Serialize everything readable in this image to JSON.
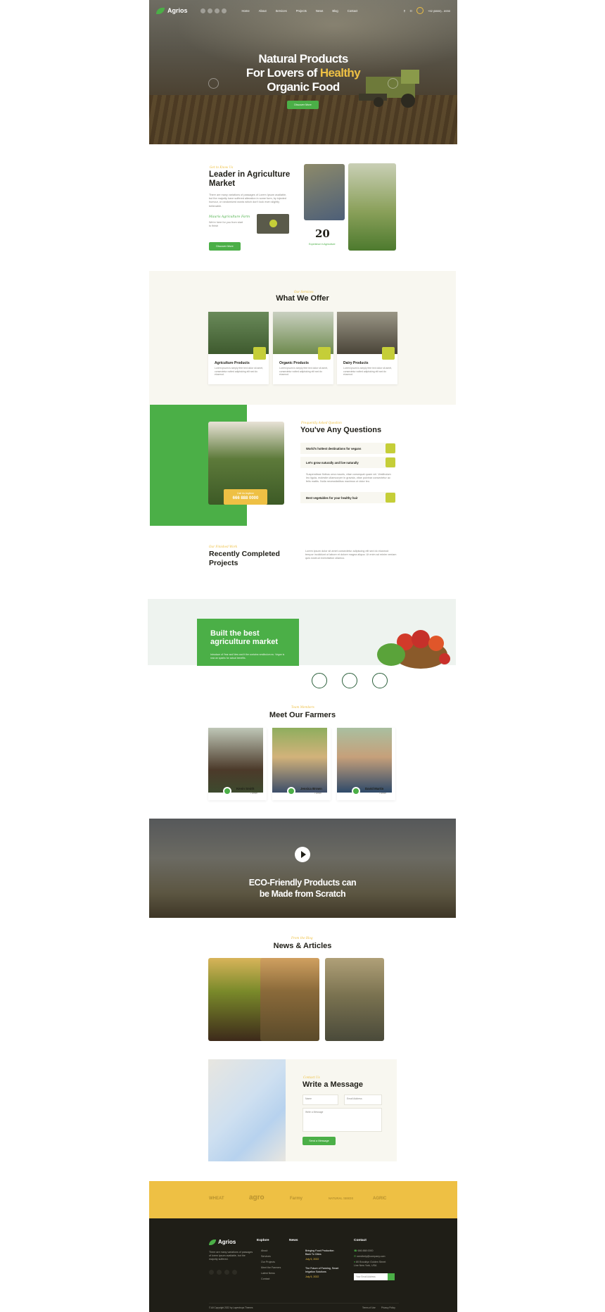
{
  "header": {
    "logo": "Agrios",
    "nav": [
      "Home",
      "About",
      "Services",
      "Projects",
      "News",
      "Blog",
      "Contact"
    ],
    "phone": "+92 (8800) - 6930"
  },
  "hero": {
    "title_line1": "Natural Products",
    "title_line2a": "For Lovers of",
    "title_line2b": "Healthy",
    "title_line3": "Organic Food",
    "button": "Discover More"
  },
  "about": {
    "tag": "Get to Know Us",
    "title": "Leader in Agriculture Market",
    "text": "There are many variations of passages of Lorem Ipsum available, but the majority have suffered alteration in some form, by injected humour, or randomized words which don't look even slightly believable.",
    "signature_note": "Mauris Agriculture Farm",
    "sub_text": "We're here for you from start to finish",
    "button": "Discover More",
    "years_number": "20",
    "years_label": "Experience in Agriculture"
  },
  "offer": {
    "tag": "Our Services",
    "title": "What We Offer",
    "cards": [
      {
        "title": "Agriculture Products",
        "text": "Lorem ipsum is simply free text dolor sit amet, consectetur notted adipisicing elit sed do eiusmod."
      },
      {
        "title": "Organic Products",
        "text": "Lorem ipsum is simply free text dolor sit amet, consectetur notted adipisicing elit sed do eiusmod."
      },
      {
        "title": "Dairy Products",
        "text": "Lorem ipsum is simply free text dolor sit amet, consectetur notted adipisicing elit sed do eiusmod."
      }
    ]
  },
  "faq": {
    "tag": "Frequently Asked Question",
    "title": "You've Any Questions",
    "call_label": "Call Us Anytime",
    "call_number": "666 888 0000",
    "items": [
      "World's hottest destinations for vegans",
      "Let's grow naturally and live naturally",
      "Best vegetables for your healthy hair"
    ],
    "answer": "Suspendisse finibus urna mauris, vitae consequat quam vel. Vestibulum leo ligula, molestie ullamcorper in gravida, vitae pulvinar consectetur ac felis mattis. Nulla necessitatibus maximus ut dolor leo."
  },
  "projects": {
    "tag": "Our Finished Work",
    "title": "Recently Completed Projects",
    "text": "Lorem ipsum dolor sit amet consectetur adipiscing elit sed do eiusmod tempor incididunt ut labore et dolore magna aliqua. Ut enim ad minim veniam quis nostrud exercitation ullamco."
  },
  "market": {
    "title": "Built the best agriculture market",
    "text": "Introduce of Year and New and it the contains vestibulum eu. Vegan is now an sparks for actual benefits."
  },
  "farmers": {
    "tag": "Team Members",
    "title": "Meet Our Farmers",
    "list": [
      {
        "name": "Kevin Smith",
        "role": "Farmer"
      },
      {
        "name": "Jessica Brown",
        "role": "Farmer"
      },
      {
        "name": "David Martin",
        "role": "Farmer"
      }
    ]
  },
  "video": {
    "title_line1": "ECO-Friendly Products can",
    "title_line2": "be Made from Scratch"
  },
  "news": {
    "tag": "From the Blog",
    "title": "News & Articles"
  },
  "contact": {
    "tag": "Contact Us",
    "title": "Write a Message",
    "name_placeholder": "Name",
    "email_placeholder": "Email Address",
    "message_placeholder": "Write a Message",
    "button": "Send a Message"
  },
  "brands": [
    "WHEAT",
    "agro",
    "Farmy",
    "NATURAL SEEDS",
    "AGRIC"
  ],
  "footer": {
    "logo": "Agrios",
    "about": "There are many variations of passages of lorem ipsum available, but the majority suffered.",
    "explore_title": "Explore",
    "explore": [
      "About",
      "Services",
      "Our Projects",
      "Meet the Farmers",
      "Latest News",
      "Contact"
    ],
    "news_title": "News",
    "news_items": [
      {
        "title": "Bringing Food Production Back To Cities",
        "date": "July 5, 2022"
      },
      {
        "title": "The Future of Farming, Smart Irrigation Solutions",
        "date": "July 5, 2022"
      }
    ],
    "contact_title": "Contact",
    "phone": "666 888 0000",
    "email": "needhelp@company.com",
    "address": "80 Brooklyn Golden Street Line New York, USA",
    "email_placeholder": "Your Email Address",
    "copyright": "© All Copyright 2022 by Layerdrops Themes",
    "terms": "Terms of Use",
    "privacy": "Privacy Policy"
  }
}
